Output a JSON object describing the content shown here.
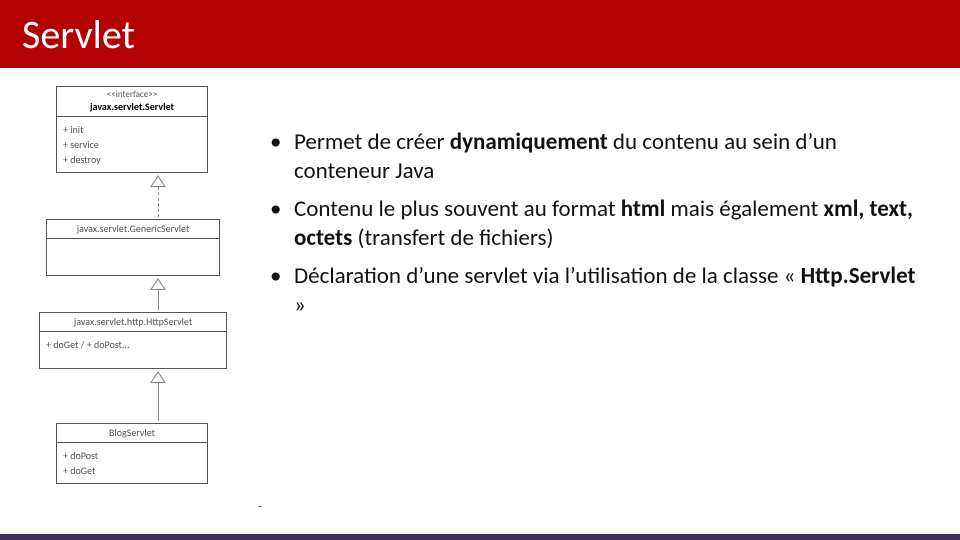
{
  "title": "Servlet",
  "uml": {
    "interface": {
      "stereotype": "<<interface>>",
      "name": "javax.servlet.Servlet",
      "ops": [
        "+ init",
        "+ service",
        "+ destroy"
      ]
    },
    "generic": {
      "name": "javax.servlet.GenericServlet"
    },
    "http": {
      "name": "javax.servlet.http.HttpServlet",
      "ops": [
        "+ doGet / + doPost..."
      ]
    },
    "blog": {
      "name": "BlogServlet",
      "ops": [
        "+ doPost",
        "+ doGet"
      ]
    }
  },
  "bullets": {
    "b1_pre": "Permet de créer ",
    "b1_bold": "dynamiquement",
    "b1_post": " du contenu au sein d’un conteneur Java",
    "b2_pre": "Contenu le plus souvent au format ",
    "b2_bold1": "html",
    "b2_mid": " mais également ",
    "b2_bold2": "xml, text, octets",
    "b2_post": " (transfert de fichiers)",
    "b3_pre": "Déclaration d’une servlet via l’utilisation de la classe « ",
    "b3_bold": "Http.Servlet",
    "b3_post": " »"
  },
  "footer_dash": "-"
}
